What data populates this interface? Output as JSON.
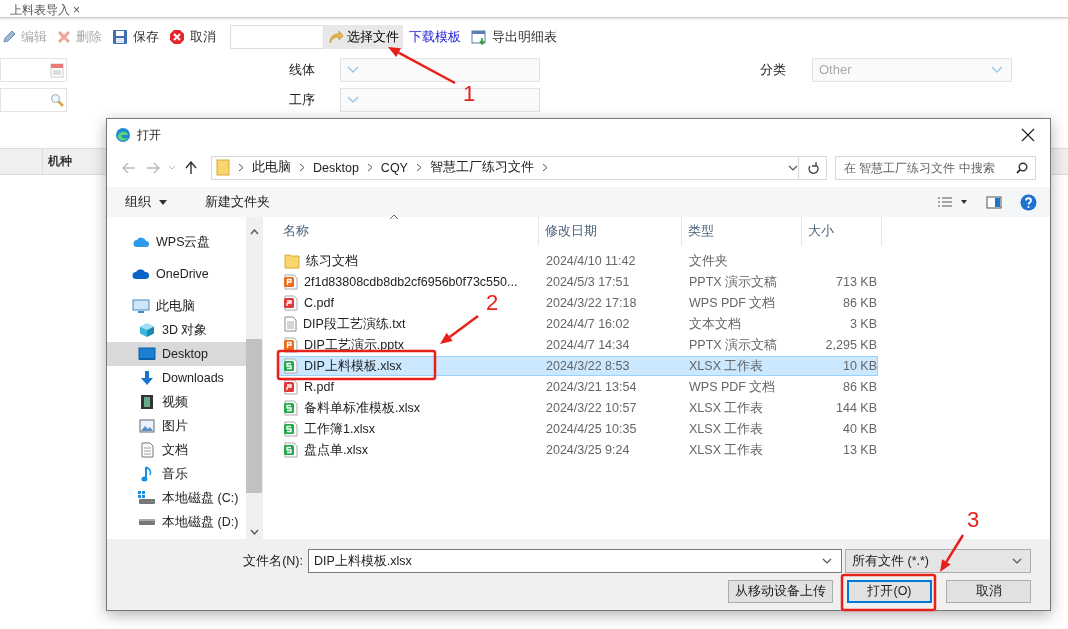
{
  "tab": {
    "title": "上料表导入",
    "close": "×"
  },
  "toolbar": [
    {
      "kind": "edit",
      "label": "编辑",
      "disabled": true
    },
    {
      "kind": "delete",
      "label": "删除",
      "disabled": true
    },
    {
      "kind": "save",
      "label": "保存",
      "disabled": false
    },
    {
      "kind": "cancel",
      "label": "取消",
      "disabled": false
    }
  ],
  "file_picker": {
    "button": "选择文件"
  },
  "actions": [
    {
      "kind": "link",
      "label": "下载模板"
    },
    {
      "kind": "export",
      "label": "导出明细表"
    }
  ],
  "form": {
    "line": {
      "label": "线体"
    },
    "process": {
      "label": "工序"
    },
    "category": {
      "label": "分类",
      "value": "Other"
    }
  },
  "table": {
    "columns": [
      "机种"
    ]
  },
  "dialog": {
    "title": "打开",
    "path": [
      "此电脑",
      "Desktop",
      "CQY",
      "智慧工厂练习文件"
    ],
    "search": {
      "placeholder": "在 智慧工厂练习文件 中搜索"
    },
    "commands": [
      {
        "label": "组织",
        "menu": true
      },
      {
        "label": "新建文件夹",
        "menu": false
      }
    ],
    "nav": [
      {
        "kind": "wps",
        "label": "WPS云盘",
        "selected": false
      },
      {
        "kind": "cloud",
        "label": "OneDrive",
        "selected": false
      },
      {
        "kind": "pc",
        "label": "此电脑",
        "selected": false,
        "children": [
          {
            "kind": "cube",
            "label": "3D 对象",
            "selected": false
          },
          {
            "kind": "desktop",
            "label": "Desktop",
            "selected": true
          },
          {
            "kind": "download",
            "label": "Downloads",
            "selected": false
          },
          {
            "kind": "video",
            "label": "视频",
            "selected": false
          },
          {
            "kind": "image",
            "label": "图片",
            "selected": false
          },
          {
            "kind": "doc",
            "label": "文档",
            "selected": false
          },
          {
            "kind": "music",
            "label": "音乐",
            "selected": false
          },
          {
            "kind": "sysdrive",
            "label": "本地磁盘 (C:)",
            "selected": false
          },
          {
            "kind": "drive",
            "label": "本地磁盘 (D:)",
            "selected": false
          }
        ]
      }
    ],
    "columns": [
      "名称",
      "修改日期",
      "类型",
      "大小"
    ],
    "files": [
      {
        "kind": "folder",
        "name": "练习文档",
        "date": "2024/4/10 11:42",
        "type": "文件夹",
        "selected": false
      },
      {
        "kind": "pptx",
        "name": "2f1d83808cdb8db2cf6956b0f73c550...",
        "date": "2024/5/3 17:51",
        "type": "PPTX 演示文稿",
        "size": "713 KB",
        "selected": false
      },
      {
        "kind": "pdf",
        "name": "C.pdf",
        "date": "2024/3/22 17:18",
        "type": "WPS PDF 文档",
        "size": "86 KB",
        "selected": false
      },
      {
        "kind": "txt",
        "name": "DIP段工艺演练.txt",
        "date": "2024/4/7 16:02",
        "type": "文本文档",
        "size": "3 KB",
        "selected": false
      },
      {
        "kind": "pptx",
        "name": "DIP工艺演示.pptx",
        "date": "2024/4/7 14:34",
        "type": "PPTX 演示文稿",
        "size": "2,295 KB",
        "selected": false
      },
      {
        "kind": "xlsx",
        "name": "DIP上料模板.xlsx",
        "date": "2024/3/22 8:53",
        "type": "XLSX 工作表",
        "size": "10 KB",
        "selected": true
      },
      {
        "kind": "pdf",
        "name": "R.pdf",
        "date": "2024/3/21 13:54",
        "type": "WPS PDF 文档",
        "size": "86 KB",
        "selected": false
      },
      {
        "kind": "xlsx",
        "name": "备料单标准模板.xlsx",
        "date": "2024/3/22 10:57",
        "type": "XLSX 工作表",
        "size": "144 KB",
        "selected": false
      },
      {
        "kind": "xlsx",
        "name": "工作簿1.xlsx",
        "date": "2024/4/25 10:35",
        "type": "XLSX 工作表",
        "size": "40 KB",
        "selected": false
      },
      {
        "kind": "xlsx",
        "name": "盘点单.xlsx",
        "date": "2024/3/25 9:24",
        "type": "XLSX 工作表",
        "size": "13 KB",
        "selected": false
      }
    ],
    "filename": {
      "label": "文件名(N):",
      "value": "DIP上料模板.xlsx"
    },
    "filter": "所有文件 (*.*)",
    "buttons": [
      {
        "label": "从移动设备上传",
        "default": false
      },
      {
        "label": "打开(O)",
        "default": true
      },
      {
        "label": "取消",
        "default": false
      }
    ]
  },
  "annotations": [
    {
      "label": "1"
    },
    {
      "label": "2"
    },
    {
      "label": "3"
    }
  ]
}
